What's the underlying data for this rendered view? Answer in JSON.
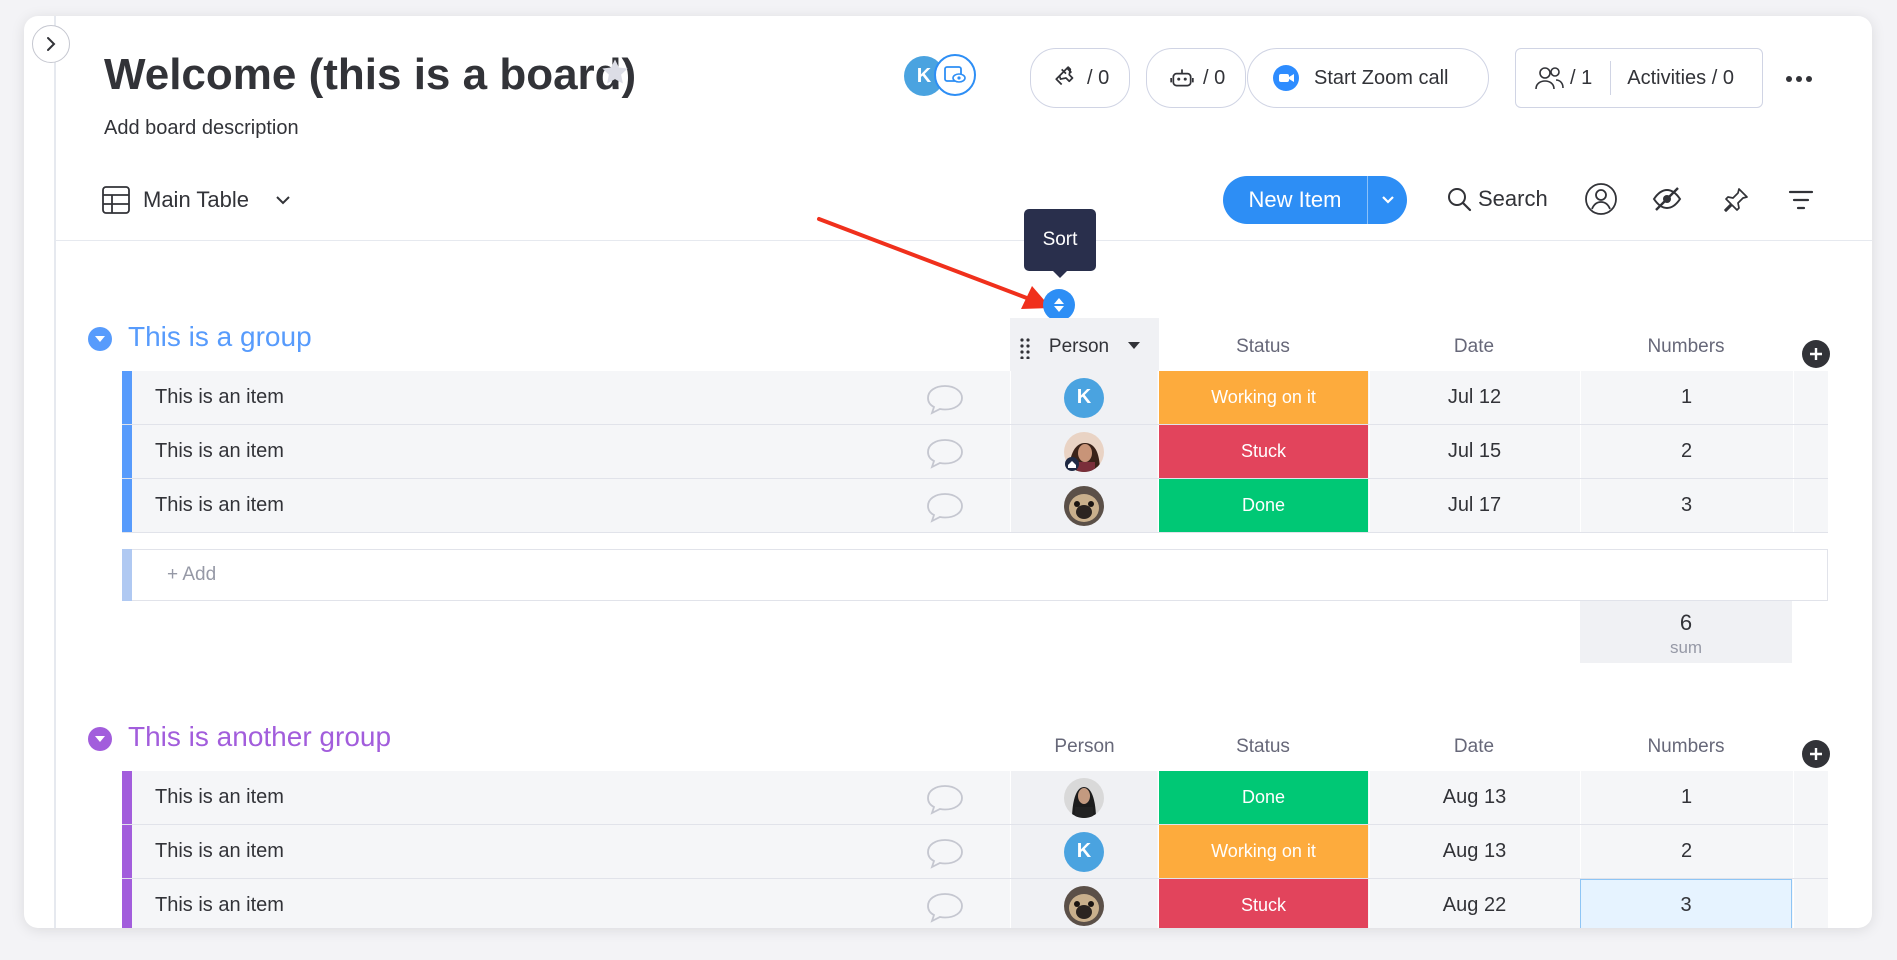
{
  "board": {
    "title": "Welcome (this is a board)",
    "description": "Add board description",
    "owner_initial": "K"
  },
  "header": {
    "integrations_count": "/ 0",
    "automations_count": "/ 0",
    "zoom_label": "Start Zoom call",
    "members_count": "/ 1",
    "activities_label": "Activities / 0"
  },
  "toolbar": {
    "view_label": "Main Table",
    "new_item_label": "New Item",
    "search_label": "Search"
  },
  "tooltip": {
    "label": "Sort"
  },
  "colors": {
    "accent": "#2d8ef5",
    "group1": "#579bfc",
    "group2": "#a25ddc",
    "working": "#fdab3d",
    "stuck": "#e2445c",
    "done": "#00c875",
    "annotation_arrow": "#f0301c"
  },
  "groups": [
    {
      "title": "This is a group",
      "columns": [
        "Person",
        "Status",
        "Date",
        "Numbers"
      ],
      "rows": [
        {
          "name": "This is an item",
          "person": "K",
          "status": "Working on it",
          "date": "Jul 12",
          "number": "1"
        },
        {
          "name": "This is an item",
          "person": "photo-woman",
          "status": "Stuck",
          "date": "Jul 15",
          "number": "2"
        },
        {
          "name": "This is an item",
          "person": "photo-dog",
          "status": "Done",
          "date": "Jul 17",
          "number": "3"
        }
      ],
      "add_label": "+ Add",
      "sum_value": "6",
      "sum_label": "sum"
    },
    {
      "title": "This is another group",
      "columns": [
        "Person",
        "Status",
        "Date",
        "Numbers"
      ],
      "rows": [
        {
          "name": "This is an item",
          "person": "photo-woman-dark",
          "status": "Done",
          "date": "Aug 13",
          "number": "1"
        },
        {
          "name": "This is an item",
          "person": "K",
          "status": "Working on it",
          "date": "Aug 13",
          "number": "2"
        },
        {
          "name": "This is an item",
          "person": "photo-dog",
          "status": "Stuck",
          "date": "Aug 22",
          "number": "3"
        }
      ]
    }
  ]
}
